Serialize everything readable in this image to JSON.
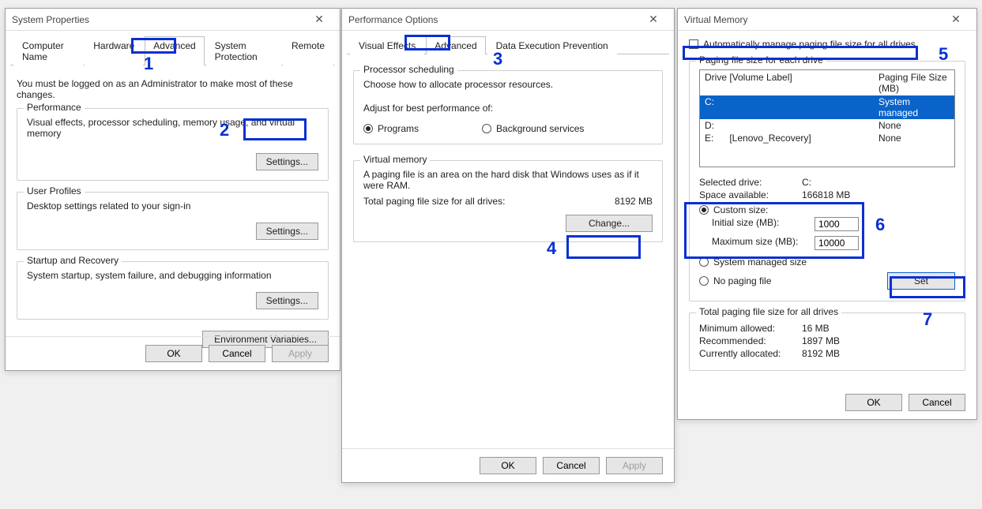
{
  "sysprop": {
    "title": "System Properties",
    "tabs": [
      "Computer Name",
      "Hardware",
      "Advanced",
      "System Protection",
      "Remote"
    ],
    "admin_note": "You must be logged on as an Administrator to make most of these changes.",
    "perf": {
      "legend": "Performance",
      "desc": "Visual effects, processor scheduling, memory usage, and virtual memory",
      "btn": "Settings..."
    },
    "profiles": {
      "legend": "User Profiles",
      "desc": "Desktop settings related to your sign-in",
      "btn": "Settings..."
    },
    "startup": {
      "legend": "Startup and Recovery",
      "desc": "System startup, system failure, and debugging information",
      "btn": "Settings..."
    },
    "envvars_btn": "Environment Variables...",
    "ok": "OK",
    "cancel": "Cancel",
    "apply": "Apply"
  },
  "perfopt": {
    "title": "Performance Options",
    "tabs": [
      "Visual Effects",
      "Advanced",
      "Data Execution Prevention"
    ],
    "procsched": {
      "legend": "Processor scheduling",
      "line1": "Choose how to allocate processor resources.",
      "line2": "Adjust for best performance of:",
      "opt_programs": "Programs",
      "opt_bg": "Background services"
    },
    "vmem": {
      "legend": "Virtual memory",
      "desc": "A paging file is an area on the hard disk that Windows uses as if it were RAM.",
      "total_label": "Total paging file size for all drives:",
      "total_value": "8192 MB",
      "change_btn": "Change..."
    },
    "ok": "OK",
    "cancel": "Cancel",
    "apply": "Apply"
  },
  "vmemdlg": {
    "title": "Virtual Memory",
    "auto_label": "Automatically manage paging file size for all drives",
    "pf_legend": "Paging file size for each drive",
    "col_drive": "Drive  [Volume Label]",
    "col_size": "Paging File Size (MB)",
    "drives": [
      {
        "label": "C:",
        "vol": "",
        "size": "System managed",
        "selected": true
      },
      {
        "label": "D:",
        "vol": "",
        "size": "None",
        "selected": false
      },
      {
        "label": "E:",
        "vol": "[Lenovo_Recovery]",
        "size": "None",
        "selected": false
      }
    ],
    "selected_drive_label": "Selected drive:",
    "selected_drive_value": "C:",
    "space_avail_label": "Space available:",
    "space_avail_value": "166818 MB",
    "custom_size": "Custom size:",
    "initial_label": "Initial size (MB):",
    "initial_value": "1000",
    "max_label": "Maximum size (MB):",
    "max_value": "10000",
    "sys_managed": "System managed size",
    "no_paging": "No paging file",
    "set_btn": "Set",
    "totals_legend": "Total paging file size for all drives",
    "min_label": "Minimum allowed:",
    "min_value": "16 MB",
    "rec_label": "Recommended:",
    "rec_value": "1897 MB",
    "cur_label": "Currently allocated:",
    "cur_value": "8192 MB",
    "ok": "OK",
    "cancel": "Cancel"
  },
  "annotations": [
    "1",
    "2",
    "3",
    "4",
    "5",
    "6",
    "7"
  ]
}
